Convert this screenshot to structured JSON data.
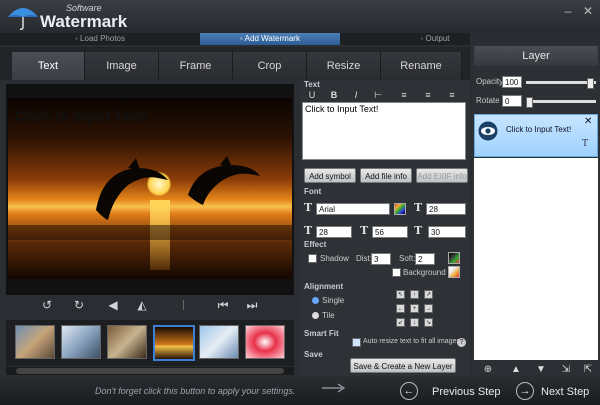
{
  "app": {
    "brand_small": "Software",
    "brand_big": "Watermark"
  },
  "window_controls": {
    "minimize": "–",
    "close": "✕"
  },
  "steps": [
    {
      "label": "◦ Load Photos"
    },
    {
      "label": "◦ Add Watermark"
    },
    {
      "label": "◦ Output"
    }
  ],
  "tabs": [
    {
      "label": "Text"
    },
    {
      "label": "Image"
    },
    {
      "label": "Frame"
    },
    {
      "label": "Crop"
    },
    {
      "label": "Resize"
    },
    {
      "label": "Rename"
    }
  ],
  "preview": {
    "watermark_text": "Click to Input Text!"
  },
  "settings": {
    "text_section": "Text",
    "text_value": "Click to Input Text!",
    "buttons": {
      "add_symbol": "Add symbol",
      "add_file_info": "Add file info",
      "add_exif_info": "Add EXIF info"
    },
    "font_section": "Font",
    "font_name": "Arial",
    "font_size": "28",
    "spin_a": "28",
    "spin_b": "56",
    "spin_c": "30",
    "effect_section": "Effect",
    "shadow_label": "Shadow",
    "dist_label": "Dist:",
    "dist_value": "3",
    "soft_label": "Soft:",
    "soft_value": "2",
    "background_label": "Background",
    "alignment_section": "Alignment",
    "single_label": "Single",
    "tile_label": "Tile",
    "smartfit_section": "Smart Fit",
    "autoresize_label": "Auto resize text to fit all images.",
    "save_section": "Save",
    "save_button": "Save & Create a New Layer"
  },
  "layer_panel": {
    "title": "Layer",
    "opacity_label": "Opacity",
    "opacity_value": "100",
    "opacity_level": 0.95,
    "rotate_label": "Rotate",
    "rotate_value": "0",
    "layer_item_text": "Click to Input Text!",
    "layer_item_type": "T"
  },
  "bottom": {
    "hint": "Don't forget click this button to apply your settings.",
    "previous": "Previous Step",
    "next": "Next Step"
  },
  "colors": {
    "accent": "#3b7fd6",
    "layer_selected": "#a8d6ff"
  }
}
